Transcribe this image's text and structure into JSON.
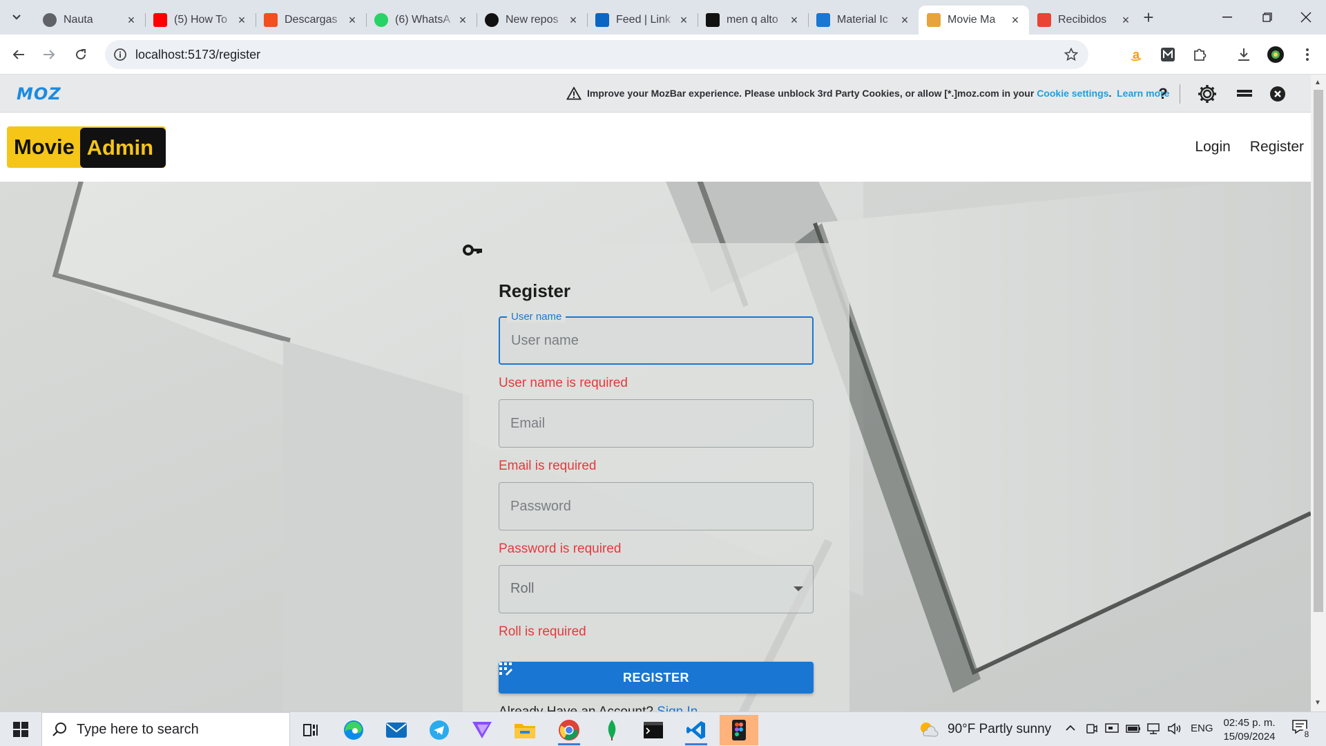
{
  "browser": {
    "tabs": [
      {
        "title": "Nauta",
        "icon": "globe-icon",
        "color": "#5f6368"
      },
      {
        "title": "(5) How To",
        "icon": "youtube-icon",
        "color": "#ff0000"
      },
      {
        "title": "Descargas",
        "icon": "figma-icon",
        "color": "#f24e1e"
      },
      {
        "title": "(6) WhatsA",
        "icon": "whatsapp-icon",
        "color": "#25d366"
      },
      {
        "title": "New repos",
        "icon": "github-icon",
        "color": "#111111"
      },
      {
        "title": "Feed | Link",
        "icon": "linkedin-icon",
        "color": "#0a66c2"
      },
      {
        "title": "men q alto",
        "icon": "p-icon",
        "color": "#111111"
      },
      {
        "title": "Material Ic",
        "icon": "mui-icon",
        "color": "#1976d2"
      },
      {
        "title": "Movie Ma",
        "icon": "movie-icon",
        "color": "#e8a33d",
        "active": true
      },
      {
        "title": "Recibidos",
        "icon": "gmail-icon",
        "color": "#ea4335"
      }
    ],
    "url": "localhost:5173/register"
  },
  "mozbar": {
    "logo": "MOZ",
    "message": "Improve your MozBar experience. Please unblock 3rd Party Cookies, or allow [*.]moz.com in your",
    "cookie_link": "Cookie settings",
    "separator": ".",
    "learn_more": "Learn more",
    "help": "?"
  },
  "app": {
    "brand_part1": "Movie",
    "brand_part2": "Admin",
    "nav_login": "Login",
    "nav_register": "Register"
  },
  "form": {
    "title": "Register",
    "username_label": "User name",
    "username_placeholder": "User name",
    "username_error": "User name is required",
    "email_placeholder": "Email",
    "email_error": "Email is required",
    "password_placeholder": "Password",
    "password_error": "Password is required",
    "roll_placeholder": "Roll",
    "roll_error": "Roll is required",
    "submit_label": "REGISTER",
    "already_text": "Already Have an Account?",
    "signin_link": "Sign In"
  },
  "taskbar": {
    "search_placeholder": "Type here to search",
    "weather": "90°F  Partly sunny",
    "language": "ENG",
    "time": "02:45 p. m.",
    "date": "15/09/2024",
    "notification_count": "8"
  },
  "colors": {
    "primary": "#1976d2",
    "error": "#e5393b",
    "brand_yellow": "#f5c518",
    "moz_blue": "#1c8be0"
  }
}
